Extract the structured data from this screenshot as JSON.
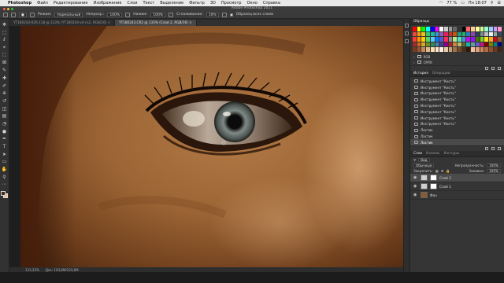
{
  "menubar": {
    "app": "Photoshop",
    "items": [
      "Файл",
      "Редактирование",
      "Изображение",
      "Слои",
      "Текст",
      "Выделение",
      "Фильтр",
      "3D",
      "Просмотр",
      "Окно",
      "Справка"
    ],
    "battery": "77 %",
    "clock": "Пн 18:07"
  },
  "window": {
    "title": "Adobe Photoshop 2021"
  },
  "options": {
    "mode_label": "Режим:",
    "mode_value": "Нормальный",
    "opacity_label": "Непрозр.:",
    "opacity_value": "100%",
    "flow_label": "Нажим:",
    "flow_value": "100%",
    "smoothing_label": "Сглаживание:",
    "smoothing_value": "10%",
    "sample_label": "Образец всех слоев"
  },
  "tabs": [
    {
      "label": "YT180243-026-118 @ 113% (YT180244-v4-cs2, RGB/16) ×"
    },
    {
      "label": "YT180243.CR2 @ 133% (Слой 2, RGB/16) ×"
    }
  ],
  "toolbar": {
    "tools": [
      "move-tool",
      "artboard-tool",
      "lasso-tool",
      "quick-select-tool",
      "crop-tool",
      "frame-tool",
      "eyedropper-tool",
      "healing-brush-tool",
      "brush-tool",
      "clone-stamp-tool",
      "history-brush-tool",
      "eraser-tool",
      "gradient-tool",
      "blur-tool",
      "dodge-tool",
      "pen-tool",
      "type-tool",
      "path-select-tool",
      "rectangle-tool",
      "hand-tool",
      "zoom-tool",
      "more-tools"
    ],
    "tool_glyphs": [
      "✥",
      "⬚",
      "ℓ",
      "⌖",
      "⛶",
      "⊠",
      "✎",
      "✚",
      "✐",
      "⎈",
      "↺",
      "◫",
      "▤",
      "◔",
      "●",
      "✒",
      "T",
      "➤",
      "▭",
      "✋",
      "⚲",
      "⋯"
    ]
  },
  "swatches": {
    "tab_label": "Образцы",
    "colors": [
      [
        "#ff0000",
        "#ffff00",
        "#00ff00",
        "#00ffff",
        "#0000ff",
        "#ff00ff",
        "#ffffff",
        "#cccccc",
        "#999999",
        "#666666",
        "#333333",
        "#000000",
        "#ff6666",
        "#ffcc99",
        "#ffff99",
        "#ccff99",
        "#99ffcc",
        "#99ccff",
        "#cc99ff",
        "#ff99cc"
      ],
      [
        "#e84c3d",
        "#f39c12",
        "#f1c40f",
        "#2ecc71",
        "#1abc9c",
        "#3498db",
        "#9b59b6",
        "#e91e63",
        "#c0392b",
        "#d35400",
        "#16a085",
        "#27ae60",
        "#2980b9",
        "#8e44ad",
        "#2c3e50",
        "#7f8c8d",
        "#bdc3c7",
        "#ecf0f1",
        "#95a5a6",
        "#34495e"
      ],
      [
        "#ff3b30",
        "#ff9500",
        "#ffcc00",
        "#4cd964",
        "#5ac8fa",
        "#007aff",
        "#5856d6",
        "#ff2d55",
        "#8e8e93",
        "#b8e986",
        "#50e3c2",
        "#4a90e2",
        "#bd10e0",
        "#9013fe",
        "#417505",
        "#7ed321",
        "#f8e71c",
        "#f5a623",
        "#d0021b",
        "#8b572a"
      ],
      [
        "#a52a2a",
        "#d2691e",
        "#daa520",
        "#6b8e23",
        "#2e8b57",
        "#4682b4",
        "#483d8b",
        "#8b008b",
        "#b22222",
        "#cd853f",
        "#bdb76b",
        "#556b2f",
        "#20b2aa",
        "#5f9ea0",
        "#6a5acd",
        "#c71585",
        "#800000",
        "#808000",
        "#008080",
        "#000080"
      ],
      [
        "#7a3b1d",
        "#a0522d",
        "#c08a5a",
        "#deb887",
        "#f5deb3",
        "#ffe4c4",
        "#fff0e0",
        "#e6c9a8",
        "#c9a27a",
        "#9c7349",
        "#6e4c2a",
        "#4a3018",
        "#2b1a0c",
        "#f4c2a1",
        "#e0a17a",
        "#cc8458",
        "#b36a40",
        "#8f4f2c",
        "#6b3820",
        "#472312"
      ]
    ],
    "folders": [
      {
        "label": "RGB"
      },
      {
        "label": "CMYK"
      }
    ]
  },
  "history": {
    "tabs": [
      "История",
      "Операции"
    ],
    "items": [
      "Инструмент \"Кисть\"",
      "Инструмент \"Кисть\"",
      "Инструмент \"Кисть\"",
      "Инструмент \"Кисть\"",
      "Инструмент \"Кисть\"",
      "Инструмент \"Кисть\"",
      "Инструмент \"Кисть\"",
      "Инструмент \"Кисть\"",
      "Ластик",
      "Ластик",
      "Ластик"
    ],
    "selected_index": 10
  },
  "layers": {
    "tabs": [
      "Слои",
      "Каналы",
      "Контуры"
    ],
    "filter_label": "Вид",
    "blend_mode": "Обычные",
    "opacity_label": "Непрозрачность:",
    "opacity_value": "100%",
    "lock_label": "Закрепить:",
    "fill_label": "Заливка:",
    "fill_value": "100%",
    "items": [
      {
        "name": "Слой 2",
        "selected": true
      },
      {
        "name": "Слой 1",
        "selected": false
      },
      {
        "name": "Фон",
        "selected": false
      }
    ]
  },
  "status": {
    "zoom": "133,33%",
    "doc": "Док: 103,8М/103,8М"
  }
}
